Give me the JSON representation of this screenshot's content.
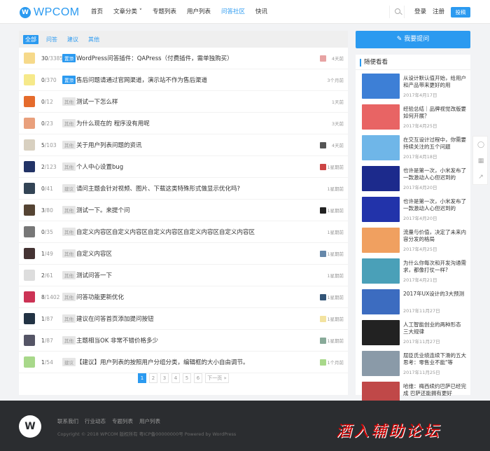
{
  "header": {
    "logo_text": "WPCOM",
    "nav": [
      "首页",
      "文章分类 ˅",
      "专题列表",
      "用户列表",
      "问答社区",
      "快讯"
    ],
    "active_nav": 4,
    "login": "登录",
    "register": "注册",
    "post": "投稿"
  },
  "tabs": [
    "全部",
    "问答",
    "建议",
    "其他"
  ],
  "questions": [
    {
      "answers": "30",
      "views": "3385",
      "tag": "置顶",
      "tag_gray": false,
      "title": "WordPress问答插件：QAPress（付费插件，需单独购买）",
      "time": "4天前",
      "avatar": "#f6d98a",
      "last": "#e7a3a3"
    },
    {
      "answers": "0",
      "views": "370",
      "tag": "置顶",
      "tag_gray": false,
      "title": "售后问题请通过官网渠道，演示站不作为售后渠道",
      "time": "3个月前",
      "avatar": "#f6e98a",
      "last": ""
    },
    {
      "answers": "0",
      "views": "12",
      "tag": "其他",
      "tag_gray": true,
      "title": "测试一下怎么样",
      "time": "1天前",
      "avatar": "#e56b2c",
      "last": ""
    },
    {
      "answers": "0",
      "views": "23",
      "tag": "其他",
      "tag_gray": true,
      "title": "为什么现在的 程序没有用呢",
      "time": "3天前",
      "avatar": "#e9a07c",
      "last": ""
    },
    {
      "answers": "5",
      "views": "103",
      "tag": "其他",
      "tag_gray": true,
      "title": "关于用户列表问题的资讯",
      "time": "4天前",
      "avatar": "#d8d0c0",
      "last": "#555555"
    },
    {
      "answers": "2",
      "views": "123",
      "tag": "其他",
      "tag_gray": true,
      "title": "个人中心设置bug",
      "time": "1星期前",
      "avatar": "#223366",
      "last": "#cc4444"
    },
    {
      "answers": "0",
      "views": "41",
      "tag": "建议",
      "tag_gray": true,
      "title": "请问主题会针对视频、图片、下载这类特殊形式做显示优化吗?",
      "time": "1星期前",
      "avatar": "#334455",
      "last": ""
    },
    {
      "answers": "3",
      "views": "80",
      "tag": "其他",
      "tag_gray": true,
      "title": "测试一下。来提个问",
      "time": "1星期前",
      "avatar": "#554433",
      "last": "#222222"
    },
    {
      "answers": "0",
      "views": "35",
      "tag": "其他",
      "tag_gray": true,
      "title": "自定义内容区自定义内容区自定义内容区自定义内容区自定义内容区",
      "time": "1星期前",
      "avatar": "#777777",
      "last": ""
    },
    {
      "answers": "1",
      "views": "49",
      "tag": "其他",
      "tag_gray": true,
      "title": "自定义内容区",
      "time": "1星期前",
      "avatar": "#443333",
      "last": "#6688aa"
    },
    {
      "answers": "2",
      "views": "61",
      "tag": "其他",
      "tag_gray": true,
      "title": "测试问答一下",
      "time": "1星期前",
      "avatar": "#dddddd",
      "last": ""
    },
    {
      "answers": "8",
      "views": "1402",
      "tag": "其他",
      "tag_gray": true,
      "title": "问答功能更新优化",
      "time": "1星期前",
      "avatar": "#cc3355",
      "last": "#335577"
    },
    {
      "answers": "1",
      "views": "87",
      "tag": "其他",
      "tag_gray": true,
      "title": "建议在问答首页添加提问按钮",
      "time": "1星期前",
      "avatar": "#223344",
      "last": "#f3e3a0"
    },
    {
      "answers": "1",
      "views": "87",
      "tag": "其他",
      "tag_gray": true,
      "title": "主题相当OK 非常不错价格多少",
      "time": "1星期前",
      "avatar": "#555566",
      "last": "#88aa99"
    },
    {
      "answers": "1",
      "views": "54",
      "tag": "建议",
      "tag_gray": true,
      "title": "【建议】用户列表的按照用户分组分类，编辑框的大小自由调节。",
      "time": "1个月前",
      "avatar": "#a8d88a",
      "last": "#a8d88a"
    }
  ],
  "pagination": [
    "1",
    "2",
    "3",
    "4",
    "5",
    "6",
    "下一页 »"
  ],
  "ask_button": "✎ 我要提问",
  "sidebar": {
    "title": "随便看看",
    "posts": [
      {
        "title": "从设计默认值开始，给用户和产品带来更好的用",
        "date": "2017年4月17日",
        "color": "#3d7fd6"
      },
      {
        "title": "经验总结｜品牌视觉改版要如何开展？",
        "date": "2017年4月25日",
        "color": "#e86464"
      },
      {
        "title": "在交互设计过程中，你需要持续关注的五个问题",
        "date": "2017年4月18日",
        "color": "#6fb6e8"
      },
      {
        "title": "也许是第一次，小米发布了一款激动人心但迟到的",
        "date": "2017年4月20日",
        "color": "#1c2a8c"
      },
      {
        "title": "也许是第一次，小米发布了一款激动人心但迟到的",
        "date": "2017年4月20日",
        "color": "#2233aa"
      },
      {
        "title": "流量与价值，决定了未来内容分发的格局",
        "date": "2017年4月25日",
        "color": "#f0a060"
      },
      {
        "title": "为什么你每次和开发沟通需求，都像打仗一样?",
        "date": "2017年4月21日",
        "color": "#4aa0b8"
      },
      {
        "title": "2017年UX设计的3大预测",
        "date": "2017年11月27日",
        "color": "#3c6cc0"
      },
      {
        "title": "人工智能创业的两种形态 三大规律",
        "date": "2017年11月27日",
        "color": "#222222"
      },
      {
        "title": "屈臣氏业绩连续下滑的五大思考：零售业不能\"等",
        "date": "2017年11月25日",
        "color": "#8a9aa8"
      },
      {
        "title": "哈维：梅西续约巴萨已经完成 巴萨还能拥有更好",
        "date": "2017年11月25日",
        "color": "#c04848"
      }
    ]
  },
  "footer": {
    "links": [
      "联系我们",
      "行业动态",
      "专题列表",
      "用户列表"
    ],
    "copyright": "Copyright © 2018 WPCOM 版权所有 粤ICP备00000000号 Powered by WordPress",
    "watermark": "酒入辅助论坛"
  },
  "float_icons": [
    "comment-icon",
    "qrcode-icon",
    "share-icon"
  ]
}
